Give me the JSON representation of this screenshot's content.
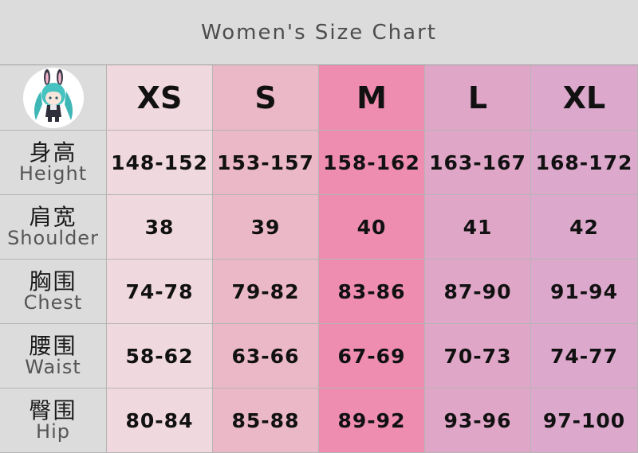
{
  "title": "Women's Size Chart",
  "sizes": [
    "XS",
    "S",
    "M",
    "L",
    "XL"
  ],
  "colors": {
    "title_bar": "#dcdcdc",
    "xs": "#f0d8df",
    "s": "#ebb8c8",
    "m": "#ee8db0",
    "l": "#e0a6c8",
    "xl": "#dca8cc"
  },
  "rows": [
    {
      "label_cn": "身高",
      "label_en": "Height",
      "values": [
        "148-152",
        "153-157",
        "158-162",
        "163-167",
        "168-172"
      ]
    },
    {
      "label_cn": "肩宽",
      "label_en": "Shoulder",
      "values": [
        "38",
        "39",
        "40",
        "41",
        "42"
      ]
    },
    {
      "label_cn": "胸围",
      "label_en": "Chest",
      "values": [
        "74-78",
        "79-82",
        "83-86",
        "87-90",
        "91-94"
      ]
    },
    {
      "label_cn": "腰围",
      "label_en": "Waist",
      "values": [
        "58-62",
        "63-66",
        "67-69",
        "70-73",
        "74-77"
      ]
    },
    {
      "label_cn": "臀围",
      "label_en": "Hip",
      "values": [
        "80-84",
        "85-88",
        "89-92",
        "93-96",
        "97-100"
      ]
    }
  ]
}
